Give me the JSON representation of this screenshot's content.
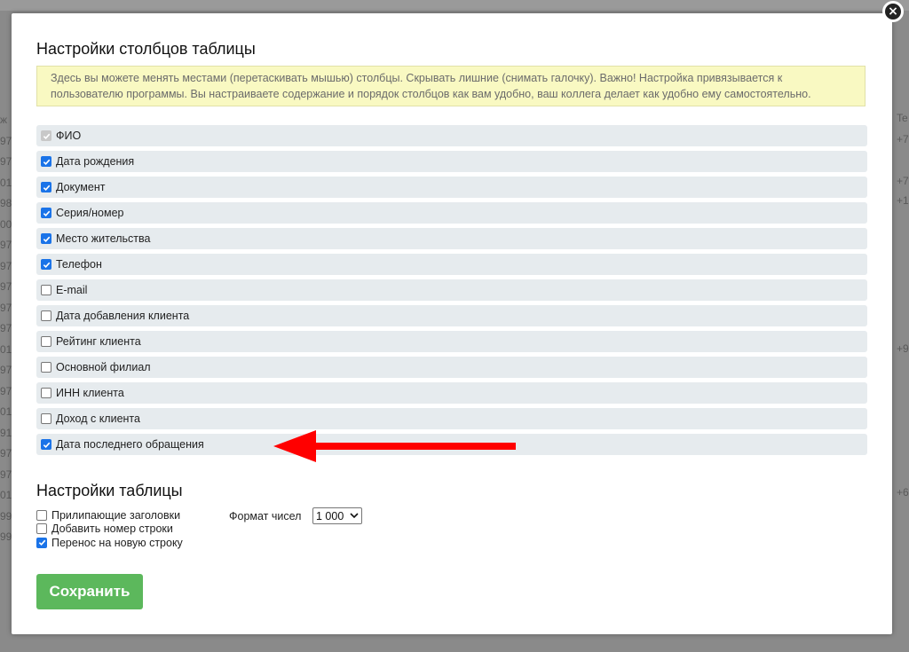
{
  "background": {
    "left_fragments": [
      "ж",
      "97",
      "97",
      "01",
      "98",
      "00",
      "97",
      "97",
      "97",
      "97",
      "97",
      "01",
      "97",
      "97",
      "01",
      "91",
      "97",
      "97",
      "01",
      "99",
      "99"
    ],
    "right_fragments": [
      "Te",
      "+7",
      "+7",
      "+1",
      "+9",
      "+6"
    ]
  },
  "modal": {
    "close_icon": "close-icon",
    "columns_title": "Настройки столбцов таблицы",
    "info_text": "Здесь вы можете менять местами (перетаскивать мышью) столбцы. Скрывать лишние (снимать галочку). Важно! Настройка привязывается к пользователю программы. Вы настраиваете содержание и порядок столбцов как вам удобно, ваш коллега делает как удобно ему самостоятельно.",
    "columns": [
      {
        "label": "ФИО",
        "checked": true,
        "disabled": true
      },
      {
        "label": "Дата рождения",
        "checked": true,
        "disabled": false
      },
      {
        "label": "Документ",
        "checked": true,
        "disabled": false
      },
      {
        "label": "Серия/номер",
        "checked": true,
        "disabled": false
      },
      {
        "label": "Место жительства",
        "checked": true,
        "disabled": false
      },
      {
        "label": "Телефон",
        "checked": true,
        "disabled": false
      },
      {
        "label": "E-mail",
        "checked": false,
        "disabled": false
      },
      {
        "label": "Дата добавления клиента",
        "checked": false,
        "disabled": false
      },
      {
        "label": "Рейтинг клиента",
        "checked": false,
        "disabled": false
      },
      {
        "label": "Основной филиал",
        "checked": false,
        "disabled": false
      },
      {
        "label": "ИНН клиента",
        "checked": false,
        "disabled": false
      },
      {
        "label": "Доход с клиента",
        "checked": false,
        "disabled": false
      },
      {
        "label": "Дата последнего обращения",
        "checked": true,
        "disabled": false
      }
    ],
    "table_title": "Настройки таблицы",
    "table_options": [
      {
        "label": "Прилипающие заголовки",
        "checked": false
      },
      {
        "label": "Добавить номер строки",
        "checked": false
      },
      {
        "label": "Перенос на новую строку",
        "checked": true
      }
    ],
    "number_format_label": "Формат чисел",
    "number_format_value": "1 000",
    "save_label": "Сохранить",
    "colors": {
      "accent_checkbox": "#1a73e8",
      "save_button": "#5cb85c",
      "info_box": "#f9f9c2",
      "row_bg": "#e6ebee",
      "arrow": "#ff0000"
    },
    "annotation_icon": "red-arrow-icon"
  }
}
